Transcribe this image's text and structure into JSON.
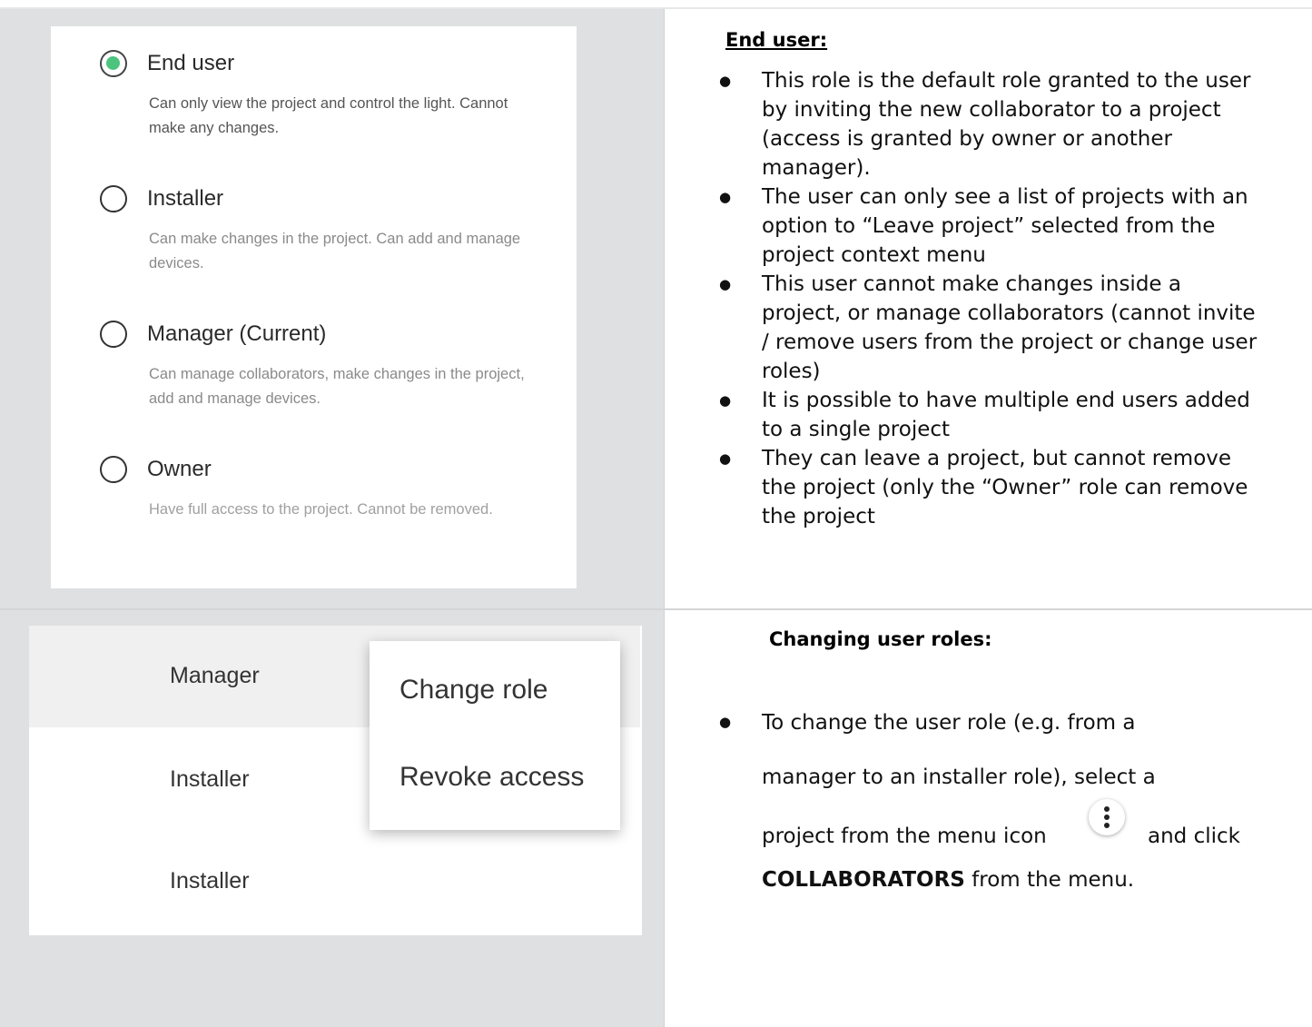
{
  "roles": [
    {
      "title": "End user",
      "desc": "Can only view the project and control the light. Cannot make any changes.",
      "checked": true
    },
    {
      "title": "Installer",
      "desc": "Can make changes in the project. Can add and manage devices.",
      "checked": false
    },
    {
      "title": "Manager (Current)",
      "desc": "Can manage collaborators, make changes in the project, add and manage devices.",
      "checked": false
    },
    {
      "title": "Owner",
      "desc": "Have full access to the project. Cannot be removed.",
      "checked": false
    }
  ],
  "end_user": {
    "heading": "End user:",
    "bullets": [
      "This role is the default role granted to the user by inviting the new collaborator to a project (access is granted by owner or another manager).",
      "The user can only see a list of projects with an option to “Leave project” selected from the project context menu",
      "This user cannot make changes inside a project, or manage collaborators (cannot invite / remove users from the project or change user roles)",
      "It is possible to have multiple end users added to a single project",
      "They can leave a project, but cannot remove the project (only the “Owner” role can remove the project"
    ]
  },
  "collaborators": {
    "rows": [
      "Manager",
      "Installer",
      "Installer"
    ],
    "menu": [
      "Change role",
      "Revoke access"
    ]
  },
  "changing": {
    "heading": "Changing user roles:",
    "line1": "To change the user role (e.g. from a",
    "line2": "manager to an installer role), select a",
    "line3a": "project from the menu icon",
    "line3b": "and click",
    "line4_bold": "COLLABORATORS",
    "line4_rest": " from the menu."
  },
  "icons": {
    "menu": "more-vert-icon",
    "radio_checked_color": "#4cc47e"
  }
}
